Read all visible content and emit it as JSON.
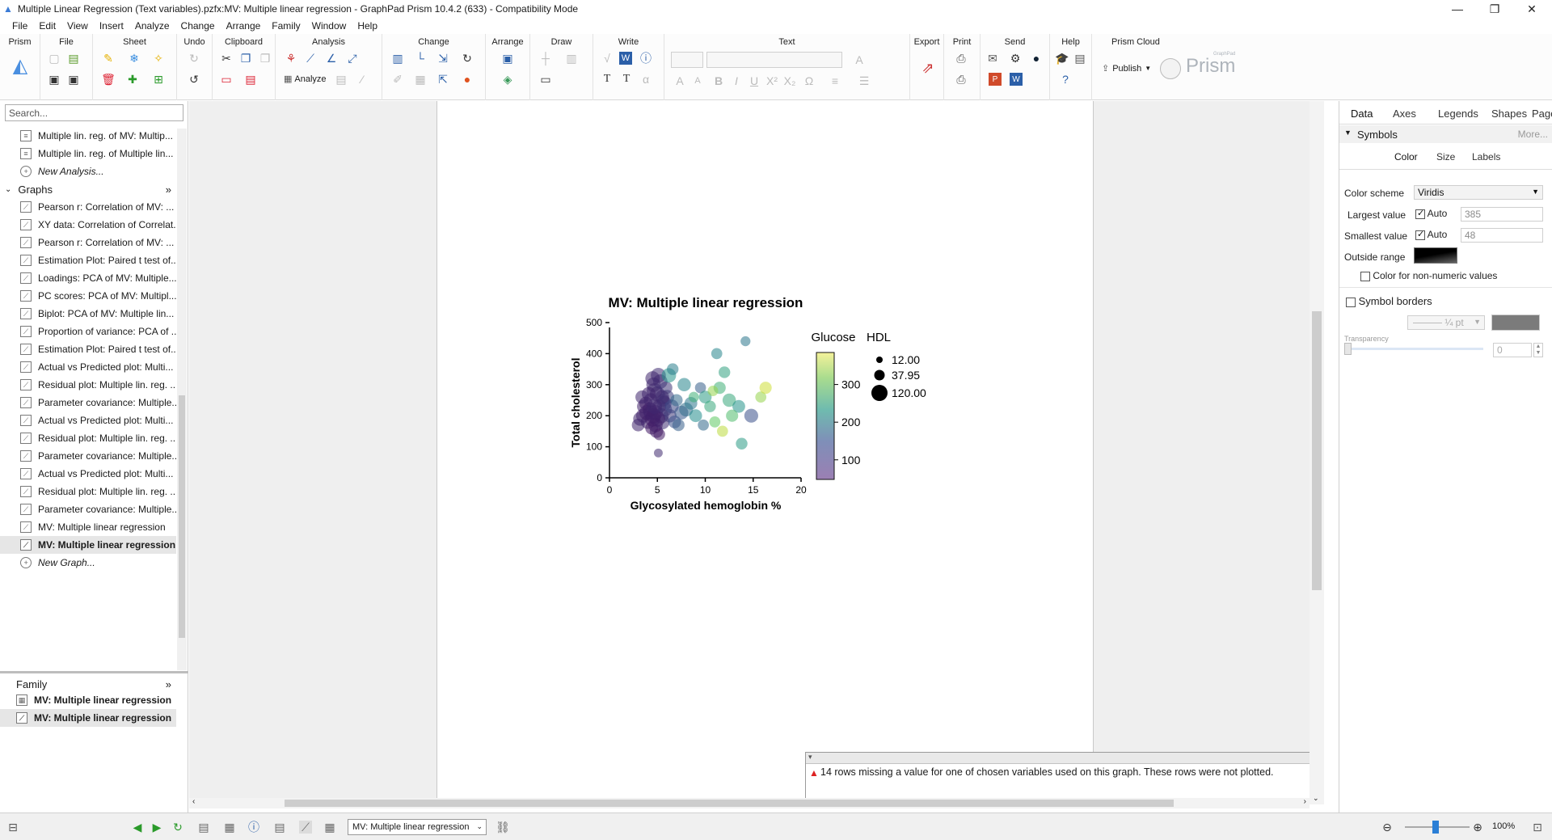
{
  "window": {
    "title": "Multiple Linear Regression (Text variables).pzfx:MV: Multiple linear regression - GraphPad Prism 10.4.2 (633) - Compatibility Mode",
    "minimize": "—",
    "maximize": "❐",
    "close": "✕"
  },
  "menu": [
    "File",
    "Edit",
    "View",
    "Insert",
    "Analyze",
    "Change",
    "Arrange",
    "Family",
    "Window",
    "Help"
  ],
  "ribbon": {
    "groups": [
      "Prism",
      "File",
      "Sheet",
      "Undo",
      "Clipboard",
      "Analysis",
      "Change",
      "Arrange",
      "Draw",
      "Write",
      "Text",
      "Export",
      "Print",
      "Send",
      "Help",
      "Prism Cloud"
    ],
    "analyze_label": "Analyze",
    "publish_label": "Publish",
    "brand": "Prism",
    "brand_small": "GraphPad"
  },
  "nav": {
    "search_placeholder": "Search...",
    "top_items": [
      "Multiple lin. reg. of MV: Multip...",
      "Multiple lin. reg. of Multiple lin..."
    ],
    "new_analysis": "New Analysis...",
    "graphs_header": "Graphs",
    "graph_items": [
      "Pearson r: Correlation of MV: ...",
      "XY data: Correlation of Correlat...",
      "Pearson r: Correlation of MV: ...",
      "Estimation Plot: Paired t test of...",
      "Loadings: PCA of MV: Multiple...",
      "PC scores: PCA of MV: Multipl...",
      "Biplot: PCA of MV: Multiple lin...",
      "Proportion of variance: PCA of ...",
      "Estimation Plot: Paired t test of...",
      "Actual vs Predicted plot: Multi...",
      "Residual plot: Multiple lin. reg. ...",
      "Parameter covariance: Multiple...",
      "Actual vs Predicted plot: Multi...",
      "Residual plot: Multiple lin. reg. ...",
      "Parameter covariance: Multiple...",
      "Actual vs Predicted plot: Multi...",
      "Residual plot: Multiple lin. reg. ...",
      "Parameter covariance: Multiple...",
      "MV: Multiple linear regression",
      "MV: Multiple linear regression"
    ],
    "new_graph": "New Graph...",
    "family_header": "Family",
    "family_items": [
      "MV: Multiple linear regression",
      "MV: Multiple linear regression"
    ]
  },
  "chart_data": {
    "type": "scatter",
    "title": "MV: Multiple linear regression",
    "xlabel": "Glycosylated hemoglobin %",
    "ylabel": "Total cholesterol",
    "xlim": [
      0,
      20
    ],
    "ylim": [
      0,
      500
    ],
    "xticks": [
      "0",
      "5",
      "10",
      "15",
      "20"
    ],
    "yticks": [
      "0",
      "100",
      "200",
      "300",
      "400",
      "500"
    ],
    "color_legend": {
      "title": "Glucose",
      "ticks": [
        "100",
        "200",
        "300"
      ],
      "min": 48,
      "max": 385
    },
    "size_legend": {
      "title": "HDL",
      "entries": [
        "12.00",
        "37.95",
        "120.00"
      ]
    },
    "points": [
      {
        "x": 4.8,
        "y": 210,
        "g": 80,
        "s": 0.9
      },
      {
        "x": 5.2,
        "y": 230,
        "g": 85,
        "s": 0.8
      },
      {
        "x": 4.5,
        "y": 190,
        "g": 75,
        "s": 0.95
      },
      {
        "x": 5.6,
        "y": 250,
        "g": 90,
        "s": 0.7
      },
      {
        "x": 4.2,
        "y": 220,
        "g": 70,
        "s": 0.85
      },
      {
        "x": 5.0,
        "y": 270,
        "g": 88,
        "s": 0.9
      },
      {
        "x": 4.0,
        "y": 180,
        "g": 82,
        "s": 0.8
      },
      {
        "x": 5.4,
        "y": 200,
        "g": 95,
        "s": 0.9
      },
      {
        "x": 3.8,
        "y": 240,
        "g": 78,
        "s": 0.75
      },
      {
        "x": 4.6,
        "y": 300,
        "g": 86,
        "s": 0.85
      },
      {
        "x": 5.8,
        "y": 220,
        "g": 100,
        "s": 0.8
      },
      {
        "x": 4.4,
        "y": 160,
        "g": 72,
        "s": 0.7
      },
      {
        "x": 5.1,
        "y": 330,
        "g": 92,
        "s": 0.9
      },
      {
        "x": 3.5,
        "y": 200,
        "g": 80,
        "s": 0.8
      },
      {
        "x": 6.0,
        "y": 260,
        "g": 110,
        "s": 0.85
      },
      {
        "x": 4.9,
        "y": 150,
        "g": 76,
        "s": 0.75
      },
      {
        "x": 3.2,
        "y": 190,
        "g": 84,
        "s": 0.8
      },
      {
        "x": 5.5,
        "y": 180,
        "g": 96,
        "s": 0.9
      },
      {
        "x": 4.7,
        "y": 280,
        "g": 90,
        "s": 0.95
      },
      {
        "x": 4.3,
        "y": 250,
        "g": 88,
        "s": 0.8
      },
      {
        "x": 5.3,
        "y": 310,
        "g": 94,
        "s": 0.85
      },
      {
        "x": 3.9,
        "y": 210,
        "g": 79,
        "s": 0.9
      },
      {
        "x": 6.3,
        "y": 200,
        "g": 105,
        "s": 0.75
      },
      {
        "x": 4.1,
        "y": 270,
        "g": 83,
        "s": 0.8
      },
      {
        "x": 5.7,
        "y": 240,
        "g": 98,
        "s": 0.9
      },
      {
        "x": 4.8,
        "y": 170,
        "g": 77,
        "s": 0.85
      },
      {
        "x": 3.6,
        "y": 230,
        "g": 81,
        "s": 0.8
      },
      {
        "x": 5.9,
        "y": 290,
        "g": 102,
        "s": 0.7
      },
      {
        "x": 4.5,
        "y": 320,
        "g": 87,
        "s": 0.85
      },
      {
        "x": 5.2,
        "y": 140,
        "g": 74,
        "s": 0.6
      },
      {
        "x": 3.0,
        "y": 170,
        "g": 85,
        "s": 0.7
      },
      {
        "x": 6.5,
        "y": 230,
        "g": 120,
        "s": 0.8
      },
      {
        "x": 4.6,
        "y": 200,
        "g": 78,
        "s": 0.9
      },
      {
        "x": 5.0,
        "y": 190,
        "g": 80,
        "s": 0.95
      },
      {
        "x": 4.3,
        "y": 210,
        "g": 83,
        "s": 0.85
      },
      {
        "x": 5.5,
        "y": 260,
        "g": 91,
        "s": 0.8
      },
      {
        "x": 3.4,
        "y": 260,
        "g": 86,
        "s": 0.75
      },
      {
        "x": 4.7,
        "y": 230,
        "g": 89,
        "s": 0.9
      },
      {
        "x": 5.1,
        "y": 80,
        "g": 90,
        "s": 0.35
      },
      {
        "x": 6.8,
        "y": 180,
        "g": 130,
        "s": 0.7
      },
      {
        "x": 7.0,
        "y": 250,
        "g": 160,
        "s": 0.65
      },
      {
        "x": 7.5,
        "y": 210,
        "g": 140,
        "s": 0.8
      },
      {
        "x": 6.2,
        "y": 330,
        "g": 220,
        "s": 0.85
      },
      {
        "x": 7.8,
        "y": 300,
        "g": 200,
        "s": 0.75
      },
      {
        "x": 6.6,
        "y": 350,
        "g": 190,
        "s": 0.6
      },
      {
        "x": 8.0,
        "y": 220,
        "g": 170,
        "s": 0.8
      },
      {
        "x": 8.5,
        "y": 240,
        "g": 180,
        "s": 0.7
      },
      {
        "x": 7.2,
        "y": 170,
        "g": 150,
        "s": 0.65
      },
      {
        "x": 9.0,
        "y": 200,
        "g": 210,
        "s": 0.7
      },
      {
        "x": 9.5,
        "y": 290,
        "g": 150,
        "s": 0.55
      },
      {
        "x": 10.0,
        "y": 260,
        "g": 230,
        "s": 0.7
      },
      {
        "x": 10.5,
        "y": 230,
        "g": 250,
        "s": 0.6
      },
      {
        "x": 11.0,
        "y": 180,
        "g": 300,
        "s": 0.55
      },
      {
        "x": 11.5,
        "y": 290,
        "g": 260,
        "s": 0.65
      },
      {
        "x": 12.0,
        "y": 340,
        "g": 240,
        "s": 0.6
      },
      {
        "x": 12.5,
        "y": 250,
        "g": 250,
        "s": 0.75
      },
      {
        "x": 11.2,
        "y": 400,
        "g": 200,
        "s": 0.55
      },
      {
        "x": 14.2,
        "y": 440,
        "g": 180,
        "s": 0.45
      },
      {
        "x": 13.5,
        "y": 230,
        "g": 220,
        "s": 0.7
      },
      {
        "x": 12.8,
        "y": 200,
        "g": 280,
        "s": 0.65
      },
      {
        "x": 13.8,
        "y": 110,
        "g": 230,
        "s": 0.6
      },
      {
        "x": 14.8,
        "y": 200,
        "g": 130,
        "s": 0.8
      },
      {
        "x": 15.8,
        "y": 260,
        "g": 330,
        "s": 0.55
      },
      {
        "x": 16.3,
        "y": 290,
        "g": 360,
        "s": 0.65
      },
      {
        "x": 11.8,
        "y": 150,
        "g": 350,
        "s": 0.55
      },
      {
        "x": 10.8,
        "y": 280,
        "g": 330,
        "s": 0.5
      },
      {
        "x": 9.8,
        "y": 170,
        "g": 160,
        "s": 0.55
      },
      {
        "x": 8.8,
        "y": 260,
        "g": 260,
        "s": 0.5
      }
    ]
  },
  "message": "14 rows missing a value for one of chosen variables used on this graph. These rows were not plotted.",
  "panel": {
    "tabs": [
      "Data",
      "Axes",
      "Legends",
      "Shapes",
      "Page"
    ],
    "section": "Symbols",
    "more": "More...",
    "subtabs": [
      "Color",
      "Size",
      "Labels"
    ],
    "color_scheme_label": "Color scheme",
    "color_scheme_value": "Viridis",
    "largest_label": "Largest value",
    "largest_auto": "Auto",
    "largest_value": "385",
    "smallest_label": "Smallest value",
    "smallest_auto": "Auto",
    "smallest_value": "48",
    "outside_label": "Outside range",
    "nonnumeric_label": "Color for non-numeric values",
    "borders_label": "Symbol borders",
    "border_width": "¼ pt",
    "transparency_label": "Transparency",
    "transparency_value": "0"
  },
  "status": {
    "sheet_select": "MV: Multiple linear regression",
    "zoom": "100%"
  }
}
